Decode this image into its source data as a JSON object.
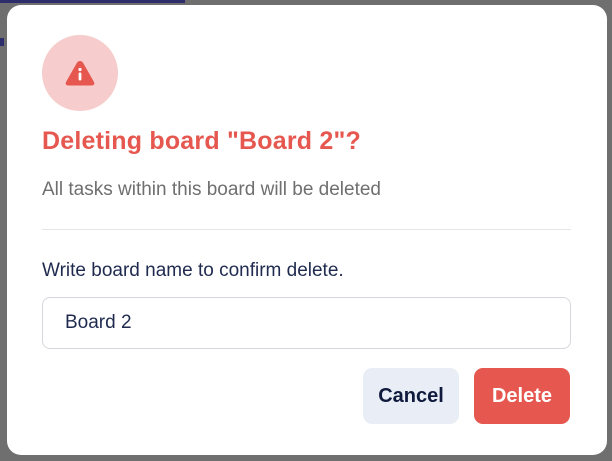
{
  "dialog": {
    "icon": "warning-info-triangle-icon",
    "title": "Deleting board \"Board 2\"?",
    "subtitle": "All tasks within this board will be deleted",
    "confirm_label": "Write board name to confirm delete.",
    "input_value": "Board 2",
    "cancel_label": "Cancel",
    "delete_label": "Delete"
  },
  "colors": {
    "danger": "#e5574f",
    "danger_light": "#f6cccc",
    "cancel_bg": "#e9eef6",
    "text_dark": "#1f2a4f",
    "text_muted": "#6f6f6f"
  }
}
